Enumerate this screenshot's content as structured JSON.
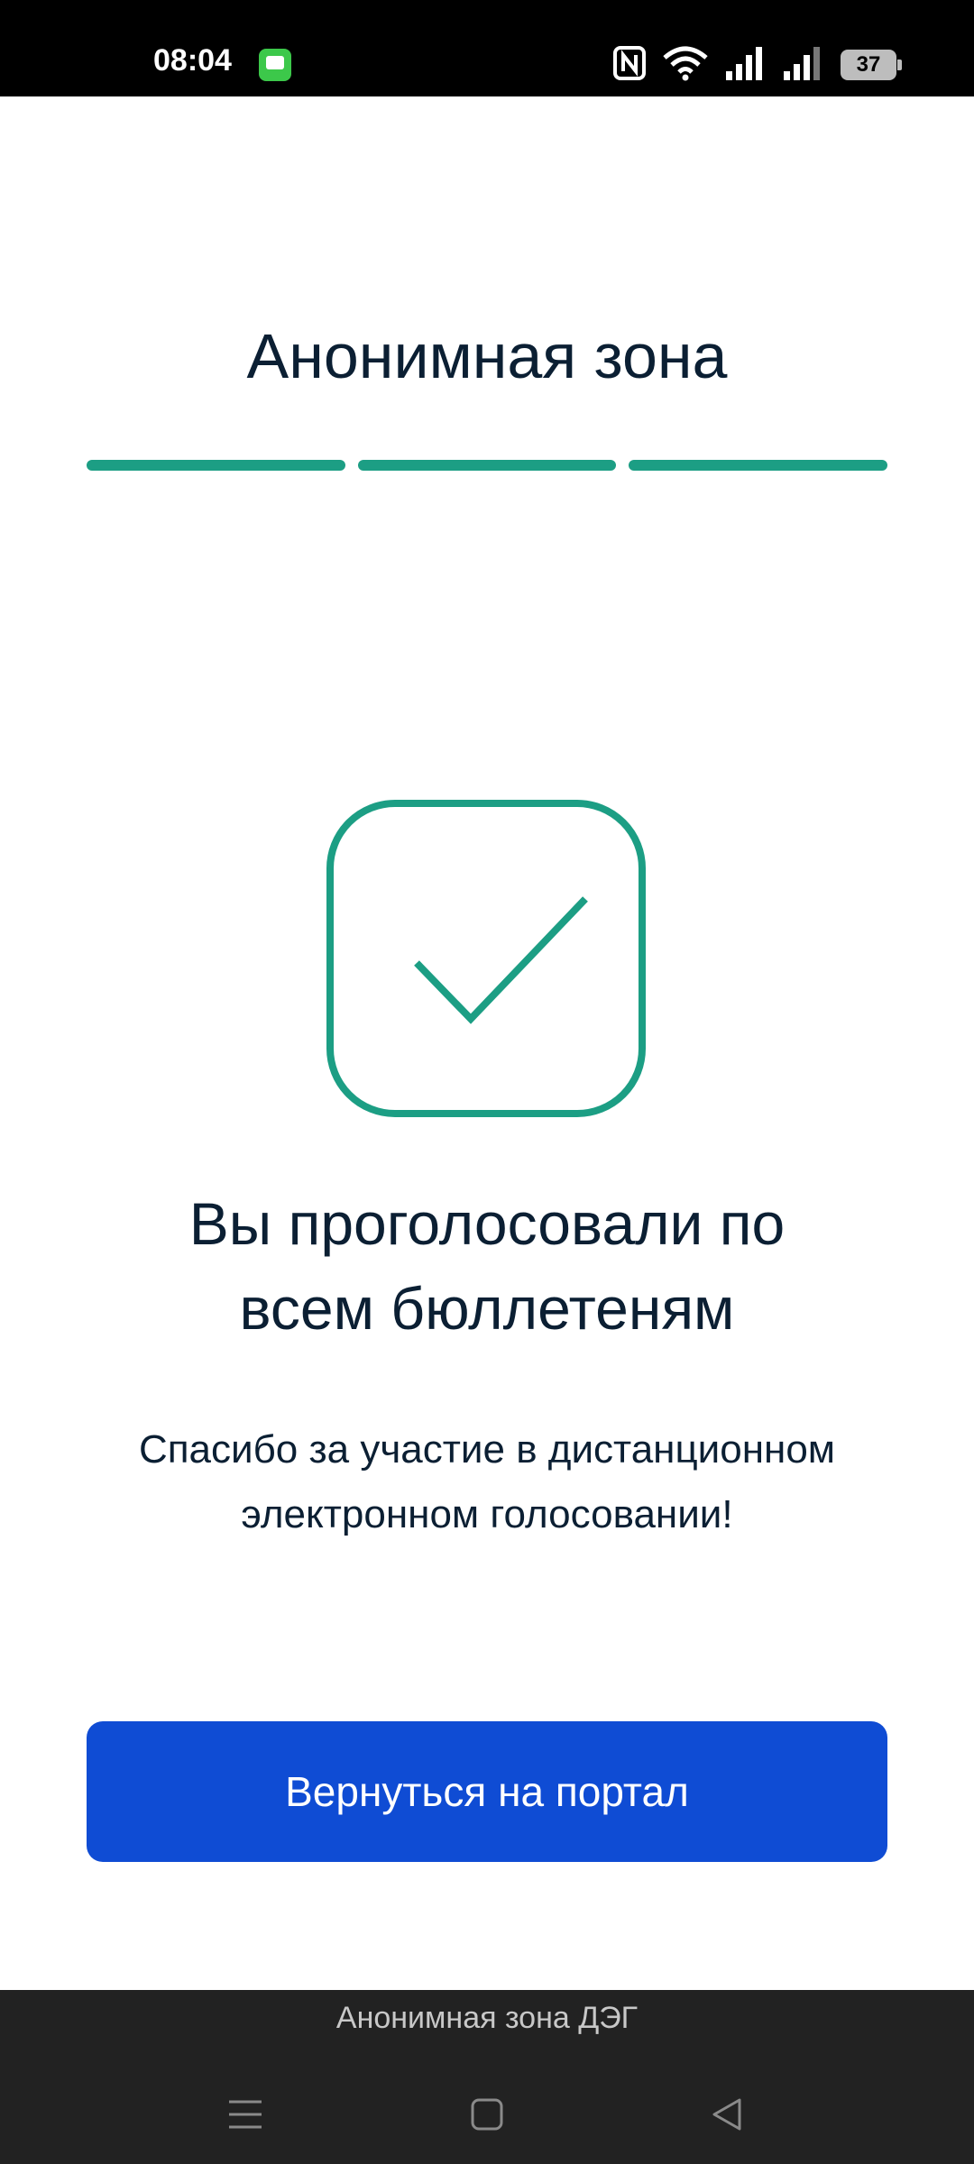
{
  "status_bar": {
    "time": "08:04",
    "battery": "37",
    "icons": [
      "message-icon",
      "nfc-icon",
      "wifi-icon",
      "signal-icon",
      "signal-icon",
      "battery-icon"
    ]
  },
  "header": {
    "title": "Анонимная зона",
    "progress_steps": 3,
    "progress_completed": 3,
    "accent_color": "#1c9e84"
  },
  "result": {
    "icon": "checkmark-icon",
    "title_line1": "Вы проголосовали по",
    "title_line2": "всем бюллетеням",
    "text_line1": "Спасибо за участие в дистанционном",
    "text_line2": "электронном голосовании!"
  },
  "actions": {
    "portal_button_label": "Вернуться на портал",
    "button_color": "#0f4cd4"
  },
  "bottom_bar": {
    "app_label": "Анонимная зона ДЭГ",
    "nav": [
      "menu-icon",
      "home-icon",
      "back-icon"
    ]
  }
}
